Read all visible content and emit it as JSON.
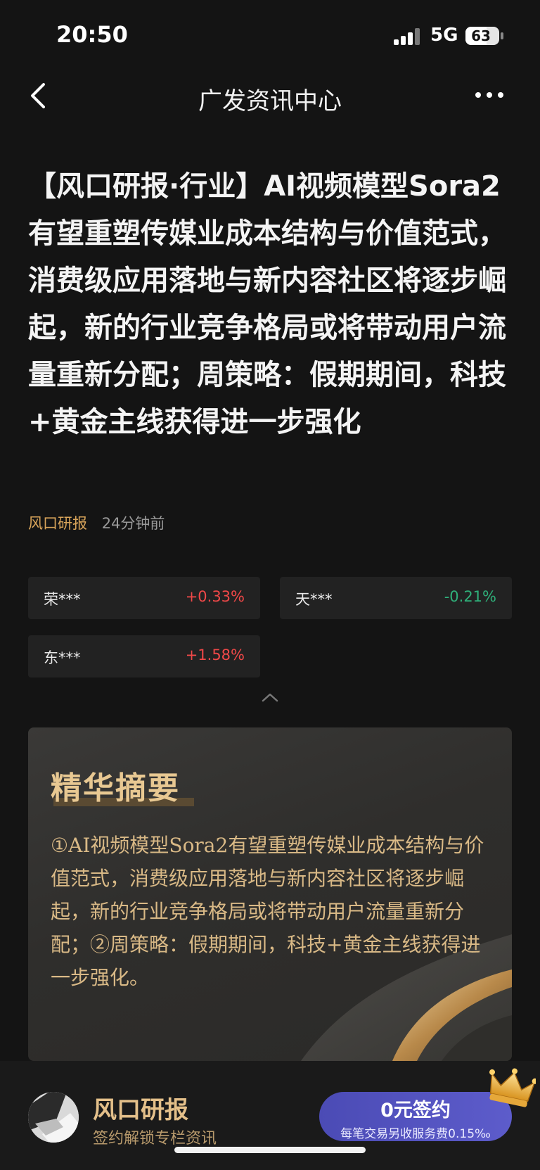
{
  "status_bar": {
    "time": "20:50",
    "network": "5G",
    "battery_level": "63",
    "battery_fraction": 0.63
  },
  "nav": {
    "title": "广发资讯中心",
    "back_icon": "chevron-left-icon",
    "more_icon": "more-horizontal-icon"
  },
  "article": {
    "title": "【风口研报·行业】AI视频模型Sora2有望重塑传媒业成本结构与价值范式，消费级应用落地与新内容社区将逐步崛起，新的行业竞争格局或将带动用户流量重新分配；周策略：假期期间，科技+黄金主线获得进一步强化",
    "source": "风口研报",
    "time_ago": "24分钟前"
  },
  "stocks": [
    {
      "name": "荣***",
      "change": "+0.33%",
      "direction": "up"
    },
    {
      "name": "天***",
      "change": "-0.21%",
      "direction": "down"
    },
    {
      "name": "东***",
      "change": "+1.58%",
      "direction": "up"
    }
  ],
  "summary": {
    "title": "精华摘要",
    "text": "①AI视频模型Sora2有望重塑传媒业成本结构与价值范式，消费级应用落地与新内容社区将逐步崛起，新的行业竞争格局或将带动用户流量重新分配；②周策略：假期期间，科技+黄金主线获得进一步强化。"
  },
  "bottom_bar": {
    "column_name": "风口研报",
    "column_subtitle": "签约解锁专栏资讯",
    "subscribe_label": "0元签约",
    "subscribe_note": "每笔交易另收服务费0.15‰",
    "crown_icon": "crown-icon"
  },
  "colors": {
    "background": "#141414",
    "accent_gold": "#d8a45a",
    "up": "#f04848",
    "down": "#2fb07a",
    "button": "#5555c0"
  }
}
